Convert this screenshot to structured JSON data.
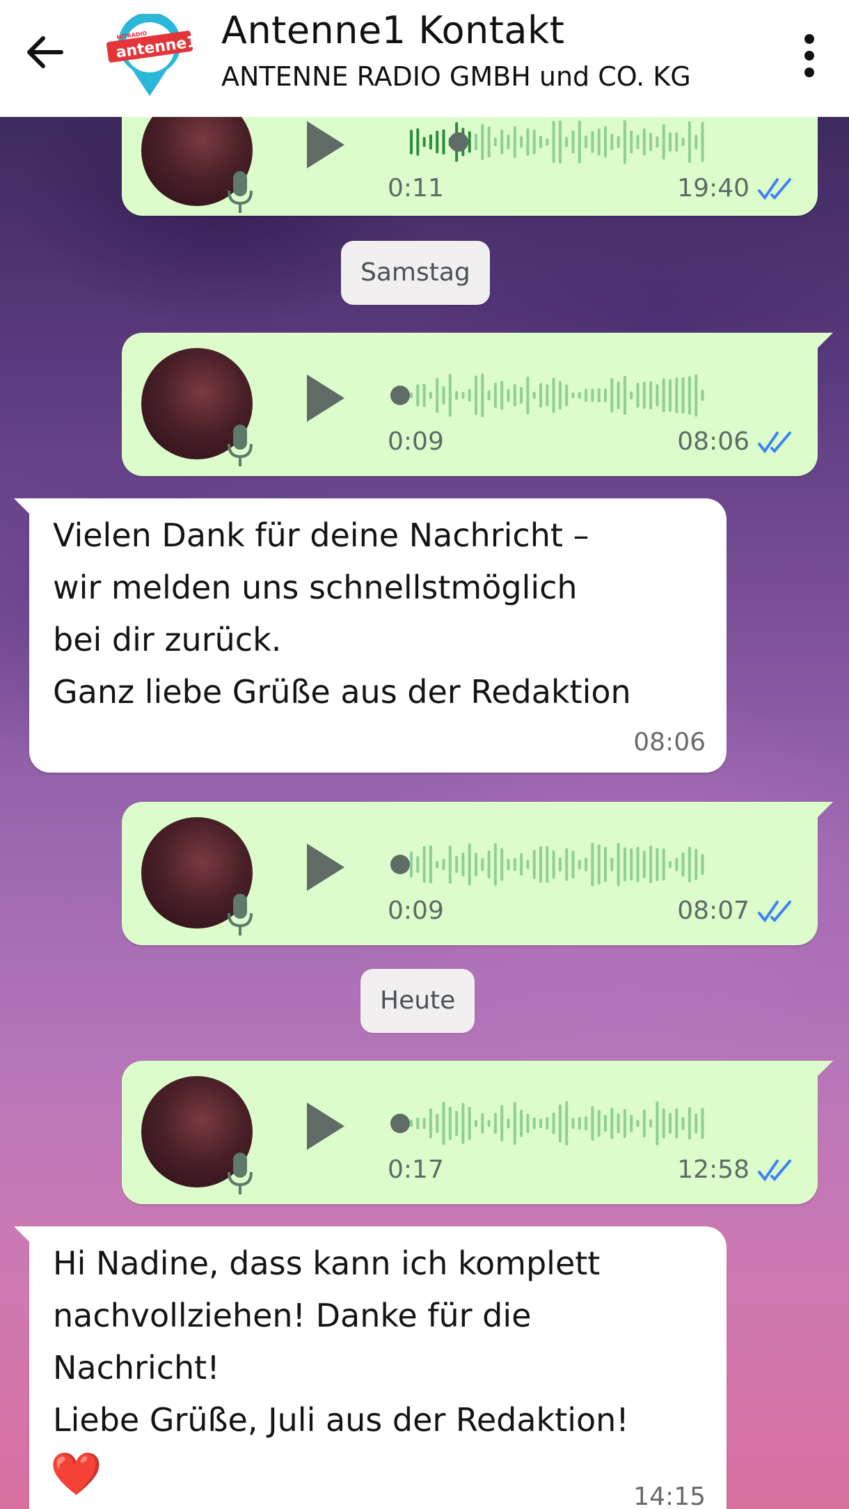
{
  "header": {
    "title": "Antenne1 Kontakt",
    "subtitle": "ANTENNE RADIO GMBH und CO. KG",
    "logo_text": "antenne1",
    "logo_small_text": "HITRADIO"
  },
  "date_separators": {
    "samstag": "Samstag",
    "heute": "Heute"
  },
  "messages": [
    {
      "type": "voice",
      "direction": "out",
      "duration": "0:11",
      "time": "19:40",
      "status": "read",
      "progress": 0.2
    },
    {
      "type": "voice",
      "direction": "out",
      "duration": "0:09",
      "time": "08:06",
      "status": "read",
      "progress": 0
    },
    {
      "type": "text",
      "direction": "in",
      "text": "Vielen Dank für deine Nachricht –\nwir melden uns schnellstmöglich\nbei dir zurück.\nGanz liebe Grüße aus der Redaktion",
      "time": "08:06"
    },
    {
      "type": "voice",
      "direction": "out",
      "duration": "0:09",
      "time": "08:07",
      "status": "read",
      "progress": 0
    },
    {
      "type": "voice",
      "direction": "out",
      "duration": "0:17",
      "time": "12:58",
      "status": "read",
      "progress": 0
    },
    {
      "type": "text",
      "direction": "in",
      "text": "Hi Nadine,  dass kann ich komplett\nnachvollziehen! Danke für die\nNachricht!\nLiebe Grüße, Juli aus der Redaktion!",
      "emoji": "❤️",
      "time": "14:15"
    }
  ],
  "colors": {
    "outgoing_bubble": "#dcfccb",
    "incoming_bubble": "#ffffff",
    "read_ticks": "#3b82f6"
  }
}
